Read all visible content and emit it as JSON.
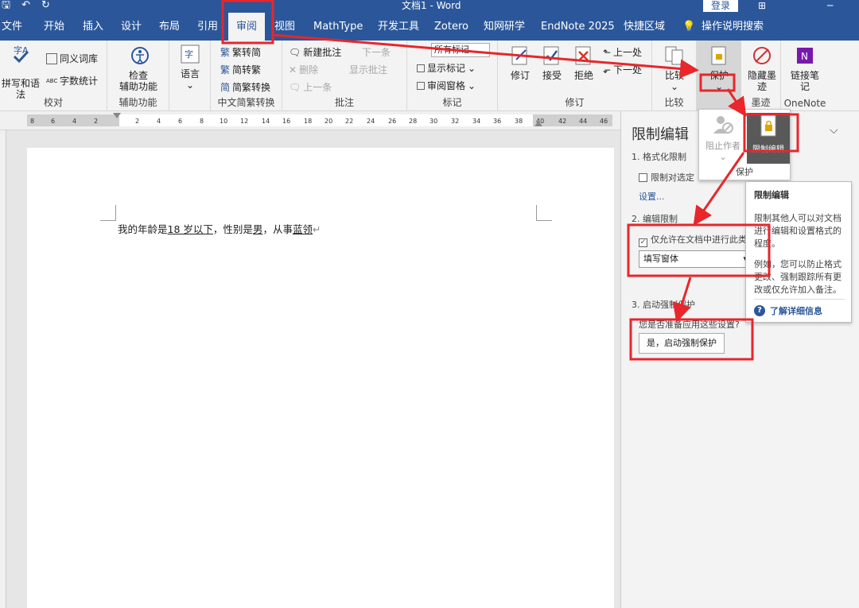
{
  "titlebar": {
    "doc_title": "文档1 - Word",
    "login": "登录"
  },
  "tabs": [
    "文件",
    "开始",
    "插入",
    "设计",
    "布局",
    "引用",
    "审阅",
    "视图",
    "MathType",
    "开发工具",
    "Zotero",
    "知网研学",
    "EndNote 2025",
    "快捷区域",
    "操作说明搜索"
  ],
  "ribbon": {
    "proofing": {
      "spell": "拼写和语法",
      "thesaurus": "同义词库",
      "wordcount": "字数统计",
      "label": "校对"
    },
    "accessibility": {
      "check": "检查",
      "check2": "辅助功能",
      "label": "辅助功能"
    },
    "language": {
      "btn": "语言"
    },
    "chinese": {
      "t2s": "繁转简",
      "s2t": "简转繁",
      "convert": "简繁转换",
      "label": "中文简繁转换"
    },
    "comments": {
      "new": "新建批注",
      "delete": "删除",
      "prev": "上一条",
      "next": "下一条",
      "show": "显示批注",
      "label": "批注"
    },
    "tracking": {
      "markup": "所有标记",
      "show_markup": "显示标记",
      "pane": "审阅窗格",
      "label": "标记"
    },
    "changes": {
      "track": "修订",
      "accept": "接受",
      "reject": "拒绝",
      "prev": "上一处",
      "next": "下一处",
      "label": "修订"
    },
    "compare": {
      "btn": "比较",
      "label": "比较"
    },
    "protect": {
      "btn": "保护"
    },
    "ink": {
      "btn": "隐藏墨迹",
      "label": "墨迹"
    },
    "onenote": {
      "btn": "链接笔记",
      "label": "OneNote"
    }
  },
  "protect_menu": {
    "block_authors": "阻止作者",
    "restrict_editing": "限制编辑",
    "label": "保护"
  },
  "ruler_numbers": [
    "8",
    "6",
    "4",
    "2",
    "2",
    "4",
    "6",
    "8",
    "10",
    "12",
    "14",
    "16",
    "18",
    "20",
    "22",
    "24",
    "26",
    "28",
    "30",
    "32",
    "34",
    "36",
    "38",
    "40",
    "42",
    "44",
    "46"
  ],
  "document": {
    "prefix": "我的年龄是",
    "age": "18 岁以下",
    "mid1": "，性别是",
    "gender": "男",
    "mid2": "，从事",
    "job": "蓝领"
  },
  "pane": {
    "title": "限制编辑",
    "sec1": "1. 格式化限制",
    "sec1_check": "限制对选定",
    "sec1_link": "设置...",
    "sec2": "2. 编辑限制",
    "sec2_check": "仅允许在文档中进行此类",
    "sec2_select": "填写窗体",
    "sec3": "3. 启动强制保护",
    "sec3_question": "您是否准备应用这些设置?",
    "sec3_button": "是，启动强制保护"
  },
  "tooltip": {
    "title": "限制编辑",
    "body1": "限制其他人可以对文档进行编辑和设置格式的程度。",
    "body2": "例如，您可以防止格式更改、强制跟踪所有更改或仅允许加入备注。",
    "link": "了解详细信息"
  },
  "colors": {
    "brand": "#2b579a",
    "annotation": "#e8262b"
  }
}
